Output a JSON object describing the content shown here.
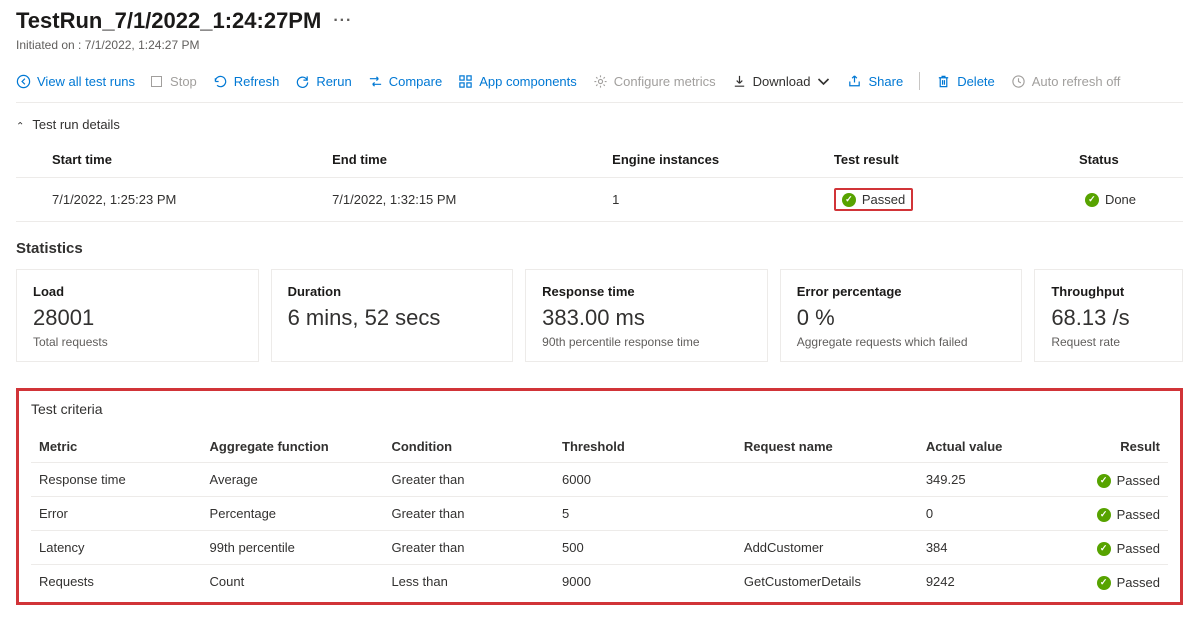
{
  "header": {
    "title": "TestRun_7/1/2022_1:24:27PM",
    "initiated_on_label": "Initiated on : 7/1/2022, 1:24:27 PM"
  },
  "toolbar": {
    "view_all": "View all test runs",
    "stop": "Stop",
    "refresh": "Refresh",
    "rerun": "Rerun",
    "compare": "Compare",
    "app_components": "App components",
    "configure_metrics": "Configure metrics",
    "download": "Download",
    "share": "Share",
    "delete": "Delete",
    "auto_refresh": "Auto refresh off"
  },
  "details": {
    "section_label": "Test run details",
    "headers": {
      "start_time": "Start time",
      "end_time": "End time",
      "engine_instances": "Engine instances",
      "test_result": "Test result",
      "status": "Status"
    },
    "row": {
      "start_time": "7/1/2022, 1:25:23 PM",
      "end_time": "7/1/2022, 1:32:15 PM",
      "engine_instances": "1",
      "test_result": "Passed",
      "status": "Done"
    }
  },
  "statistics": {
    "title": "Statistics",
    "cards": [
      {
        "label": "Load",
        "value": "28001",
        "sub": "Total requests"
      },
      {
        "label": "Duration",
        "value": "6 mins, 52 secs",
        "sub": ""
      },
      {
        "label": "Response time",
        "value": "383.00 ms",
        "sub": "90th percentile response time"
      },
      {
        "label": "Error percentage",
        "value": "0 %",
        "sub": "Aggregate requests which failed"
      },
      {
        "label": "Throughput",
        "value": "68.13 /s",
        "sub": "Request rate"
      }
    ]
  },
  "criteria": {
    "title": "Test criteria",
    "headers": {
      "metric": "Metric",
      "aggregate": "Aggregate function",
      "condition": "Condition",
      "threshold": "Threshold",
      "request_name": "Request name",
      "actual_value": "Actual value",
      "result": "Result"
    },
    "rows": [
      {
        "metric": "Response time",
        "aggregate": "Average",
        "condition": "Greater than",
        "threshold": "6000",
        "request_name": "",
        "actual_value": "349.25",
        "result": "Passed"
      },
      {
        "metric": "Error",
        "aggregate": "Percentage",
        "condition": "Greater than",
        "threshold": "5",
        "request_name": "",
        "actual_value": "0",
        "result": "Passed"
      },
      {
        "metric": "Latency",
        "aggregate": "99th percentile",
        "condition": "Greater than",
        "threshold": "500",
        "request_name": "AddCustomer",
        "actual_value": "384",
        "result": "Passed"
      },
      {
        "metric": "Requests",
        "aggregate": "Count",
        "condition": "Less than",
        "threshold": "9000",
        "request_name": "GetCustomerDetails",
        "actual_value": "9242",
        "result": "Passed"
      }
    ]
  }
}
